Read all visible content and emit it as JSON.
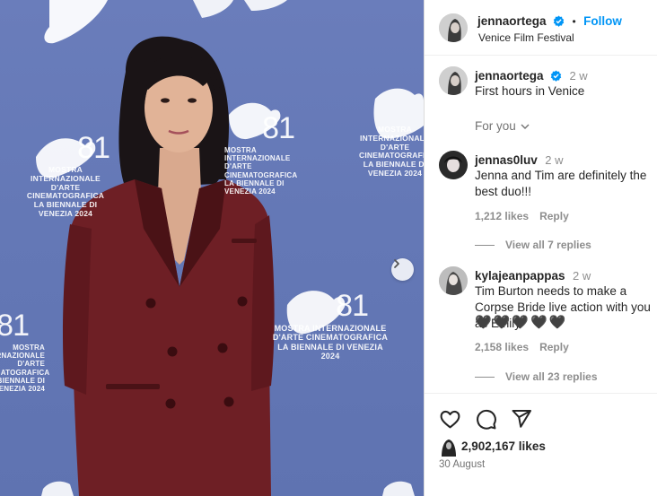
{
  "post": {
    "author": "jennaortega",
    "follow_label": "Follow",
    "location": "Venice Film Festival",
    "separator": "•",
    "caption": {
      "author": "jennaortega",
      "time": "2 w",
      "text": "First hours in Venice"
    },
    "for_you_label": "For you",
    "likes": "2,902,167 likes",
    "date": "30 August"
  },
  "media": {
    "backdrop_color": "#6679b7",
    "watermark": {
      "number": "81",
      "line1": "MOSTRA INTERNAZIONALE",
      "line2": "D'ARTE CINEMATOGRAFICA",
      "line3": "LA BIENNALE DI VENEZIA 2024"
    }
  },
  "comments": [
    {
      "user": "jennas0luv",
      "time": "2 w",
      "text": "Jenna and Tim are definitely the best duo!!!",
      "likes": "1,212 likes",
      "reply_label": "Reply",
      "view_replies": "View all 7 replies"
    },
    {
      "user": "kylajeanpappas",
      "time": "2 w",
      "text": "Tim Burton needs to make a Corpse Bride live action with you as Emily",
      "emoji": "🖤🖤🖤🖤🖤",
      "likes": "2,158 likes",
      "reply_label": "Reply",
      "view_replies": "View all 23 replies"
    }
  ],
  "colors": {
    "accent": "#0095f6",
    "verified": "#0095f6",
    "muted": "#8e8e8e"
  },
  "icons": [
    "like-heart-icon",
    "comment-icon",
    "share-icon",
    "chevron-right-icon",
    "chevron-down-icon",
    "verified-badge-icon"
  ]
}
